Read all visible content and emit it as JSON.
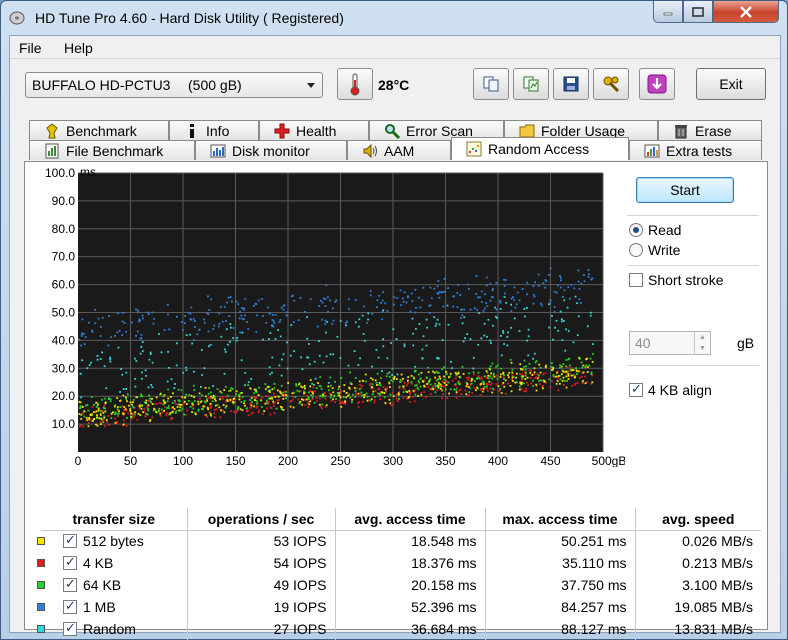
{
  "window": {
    "title": "HD Tune Pro 4.60 - Hard Disk Utility ( Registered)"
  },
  "menu": {
    "file": "File",
    "help": "Help"
  },
  "toolbar": {
    "drive_name": "BUFFALO HD-PCTU3",
    "drive_capacity": "(500 gB)",
    "temperature": "28°C",
    "exit_label": "Exit"
  },
  "tabs_row1": [
    {
      "label": "Benchmark",
      "icon": "benchmark-icon"
    },
    {
      "label": "Info",
      "icon": "info-icon"
    },
    {
      "label": "Health",
      "icon": "health-icon"
    },
    {
      "label": "Error Scan",
      "icon": "error-scan-icon"
    },
    {
      "label": "Folder Usage",
      "icon": "folder-icon"
    },
    {
      "label": "Erase",
      "icon": "erase-icon"
    }
  ],
  "tabs_row2": [
    {
      "label": "File Benchmark",
      "icon": "file-benchmark-icon"
    },
    {
      "label": "Disk monitor",
      "icon": "disk-monitor-icon"
    },
    {
      "label": "AAM",
      "icon": "speaker-icon"
    },
    {
      "label": "Random Access",
      "icon": "random-access-icon"
    },
    {
      "label": "Extra tests",
      "icon": "extra-tests-icon"
    }
  ],
  "controls": {
    "start_label": "Start",
    "read_label": "Read",
    "write_label": "Write",
    "mode_selected": "Read",
    "short_stroke_label": "Short stroke",
    "short_stroke_checked": false,
    "short_stroke_value": "40",
    "short_stroke_unit": "gB",
    "align_label": "4 KB align",
    "align_checked": true
  },
  "chart_data": {
    "type": "scatter",
    "ylabel": "ms",
    "xlabel": "",
    "xunit": "gB",
    "xlim": [
      0,
      500
    ],
    "ylim": [
      0,
      100
    ],
    "x_ticks": [
      "0",
      "50",
      "100",
      "150",
      "200",
      "250",
      "300",
      "350",
      "400",
      "450",
      "500gB"
    ],
    "y_ticks": [
      "10.0",
      "20.0",
      "30.0",
      "40.0",
      "50.0",
      "60.0",
      "70.0",
      "80.0",
      "90.0",
      "100.0"
    ],
    "grid": true,
    "background": "#1a1a1a",
    "series": [
      {
        "name": "512 bytes",
        "color": "#f5e400",
        "y_start": 14,
        "y_end": 30,
        "spread": 5
      },
      {
        "name": "4 KB",
        "color": "#e01e1e",
        "y_start": 12,
        "y_end": 28,
        "spread": 4
      },
      {
        "name": "64 KB",
        "color": "#28d228",
        "y_start": 15,
        "y_end": 31,
        "spread": 5
      },
      {
        "name": "1 MB",
        "color": "#2e7fd8",
        "y_start": 45,
        "y_end": 60,
        "spread": 7
      },
      {
        "name": "Random",
        "color": "#35d8d8",
        "y_start": 28,
        "y_end": 48,
        "spread": 12
      }
    ]
  },
  "results": {
    "headers": [
      "transfer size",
      "operations / sec",
      "avg. access time",
      "max. access time",
      "avg. speed"
    ],
    "rows": [
      {
        "color": "#f5e400",
        "label": "512 bytes",
        "ops": "53 IOPS",
        "avg": "18.548 ms",
        "max": "50.251 ms",
        "speed": "0.026 MB/s"
      },
      {
        "color": "#e01e1e",
        "label": "4 KB",
        "ops": "54 IOPS",
        "avg": "18.376 ms",
        "max": "35.110 ms",
        "speed": "0.213 MB/s"
      },
      {
        "color": "#28d228",
        "label": "64 KB",
        "ops": "49 IOPS",
        "avg": "20.158 ms",
        "max": "37.750 ms",
        "speed": "3.100 MB/s"
      },
      {
        "color": "#2e7fd8",
        "label": "1 MB",
        "ops": "19 IOPS",
        "avg": "52.396 ms",
        "max": "84.257 ms",
        "speed": "19.085 MB/s"
      },
      {
        "color": "#35d8d8",
        "label": "Random",
        "ops": "27 IOPS",
        "avg": "36.684 ms",
        "max": "88.127 ms",
        "speed": "13.831 MB/s"
      }
    ]
  }
}
